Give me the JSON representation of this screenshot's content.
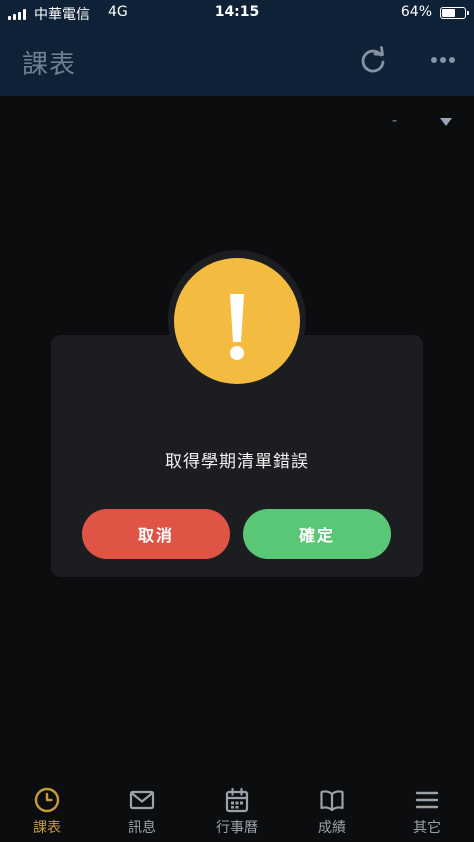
{
  "status_bar": {
    "carrier": "中華電信",
    "network": "4G",
    "time": "14:15",
    "battery": "64%",
    "battery_level": 0.64
  },
  "header": {
    "title": "課表",
    "icons": [
      "refresh-icon",
      "more-icon"
    ]
  },
  "term_select": {
    "value": "-"
  },
  "dialog": {
    "icon": "warning-icon",
    "message": "取得學期清單錯誤",
    "cancel_label": "取消",
    "confirm_label": "確定"
  },
  "tabs": [
    {
      "label": "課表",
      "icon": "clock-icon",
      "active": true
    },
    {
      "label": "訊息",
      "icon": "mail-icon",
      "active": false
    },
    {
      "label": "行事曆",
      "icon": "calendar-icon",
      "active": false
    },
    {
      "label": "成績",
      "icon": "book-icon",
      "active": false
    },
    {
      "label": "其它",
      "icon": "menu-icon",
      "active": false
    }
  ],
  "colors": {
    "header_bg": "#0e2137",
    "warning": "#f3bb40",
    "cancel": "#e05445",
    "confirm": "#5ac776",
    "active_tab": "#c99a3a"
  }
}
